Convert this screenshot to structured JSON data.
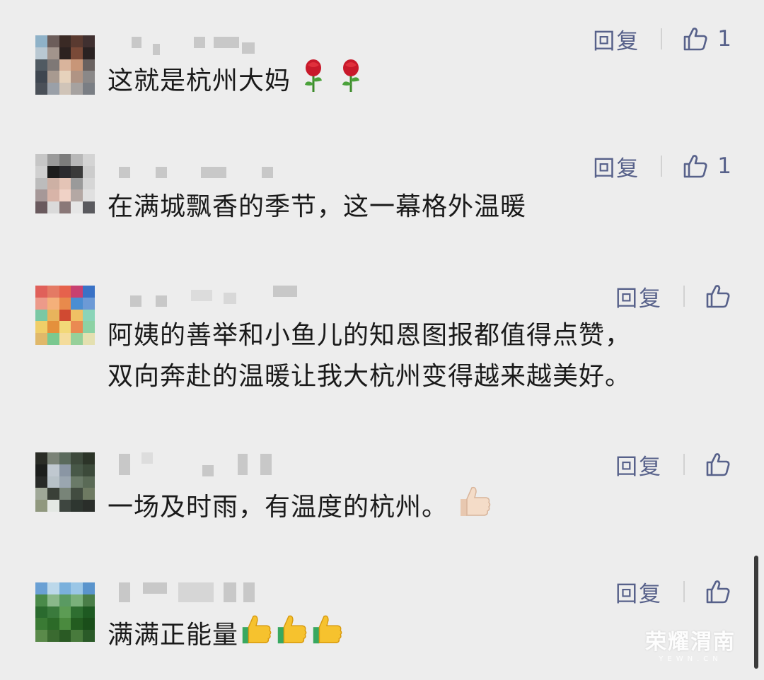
{
  "comments": [
    {
      "text": "这就是杭州大妈",
      "reply_label": "回复",
      "like_count": "1",
      "emoji": "rose-icon x2"
    },
    {
      "text": "在满城飘香的季节，这一幕格外温暖",
      "reply_label": "回复",
      "like_count": "1"
    },
    {
      "lines": [
        "阿姨的善举和小鱼儿的知恩图报都值得点赞，",
        "双向奔赴的温暖让我大杭州变得越来越美好。"
      ],
      "reply_label": "回复"
    },
    {
      "text": "一场及时雨，有温度的杭州。",
      "reply_label": "回复",
      "emoji": "thumbs-up-icon"
    },
    {
      "text": "满满正能量",
      "reply_label": "回复",
      "emoji": "thumbs-up-icon x3"
    }
  ],
  "watermark": {
    "main": "荣耀渭南",
    "sub": "YEWN.CN"
  },
  "colors": {
    "background": "#ededed",
    "link": "#57618a",
    "text": "#1a1a1a"
  }
}
